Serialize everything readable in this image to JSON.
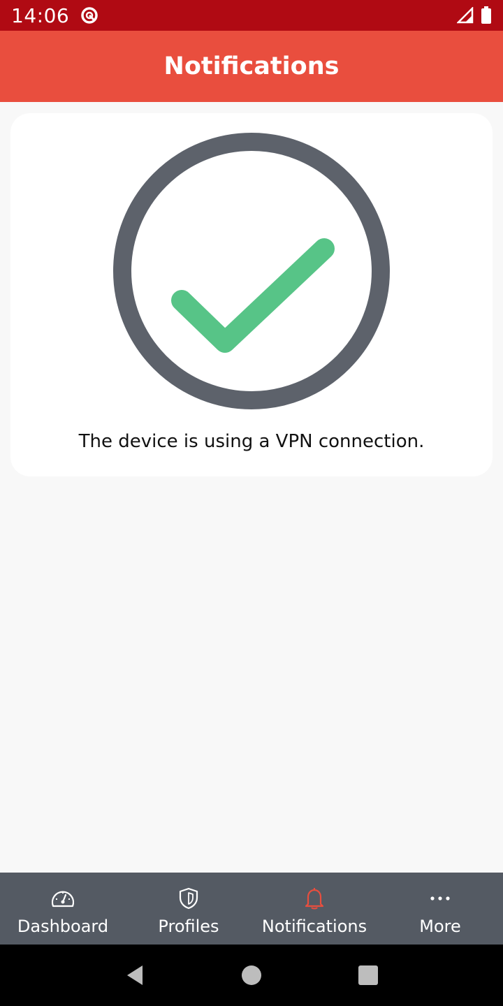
{
  "status_bar": {
    "time": "14:06"
  },
  "header": {
    "title": "Notifications"
  },
  "card": {
    "message": "The device is using a VPN connection."
  },
  "bottom_nav": {
    "items": [
      {
        "label": "Dashboard",
        "icon": "speedometer-icon"
      },
      {
        "label": "Profiles",
        "icon": "shield-icon"
      },
      {
        "label": "Notifications",
        "icon": "bell-icon",
        "active": true
      },
      {
        "label": "More",
        "icon": "more-dots-icon"
      }
    ]
  },
  "colors": {
    "status_bar": "#b00a13",
    "header": "#e94e3e",
    "nav_background": "#545a63",
    "active_icon": "#e94e3e",
    "check_green": "#57c487",
    "ring_gray": "#5d626b"
  }
}
